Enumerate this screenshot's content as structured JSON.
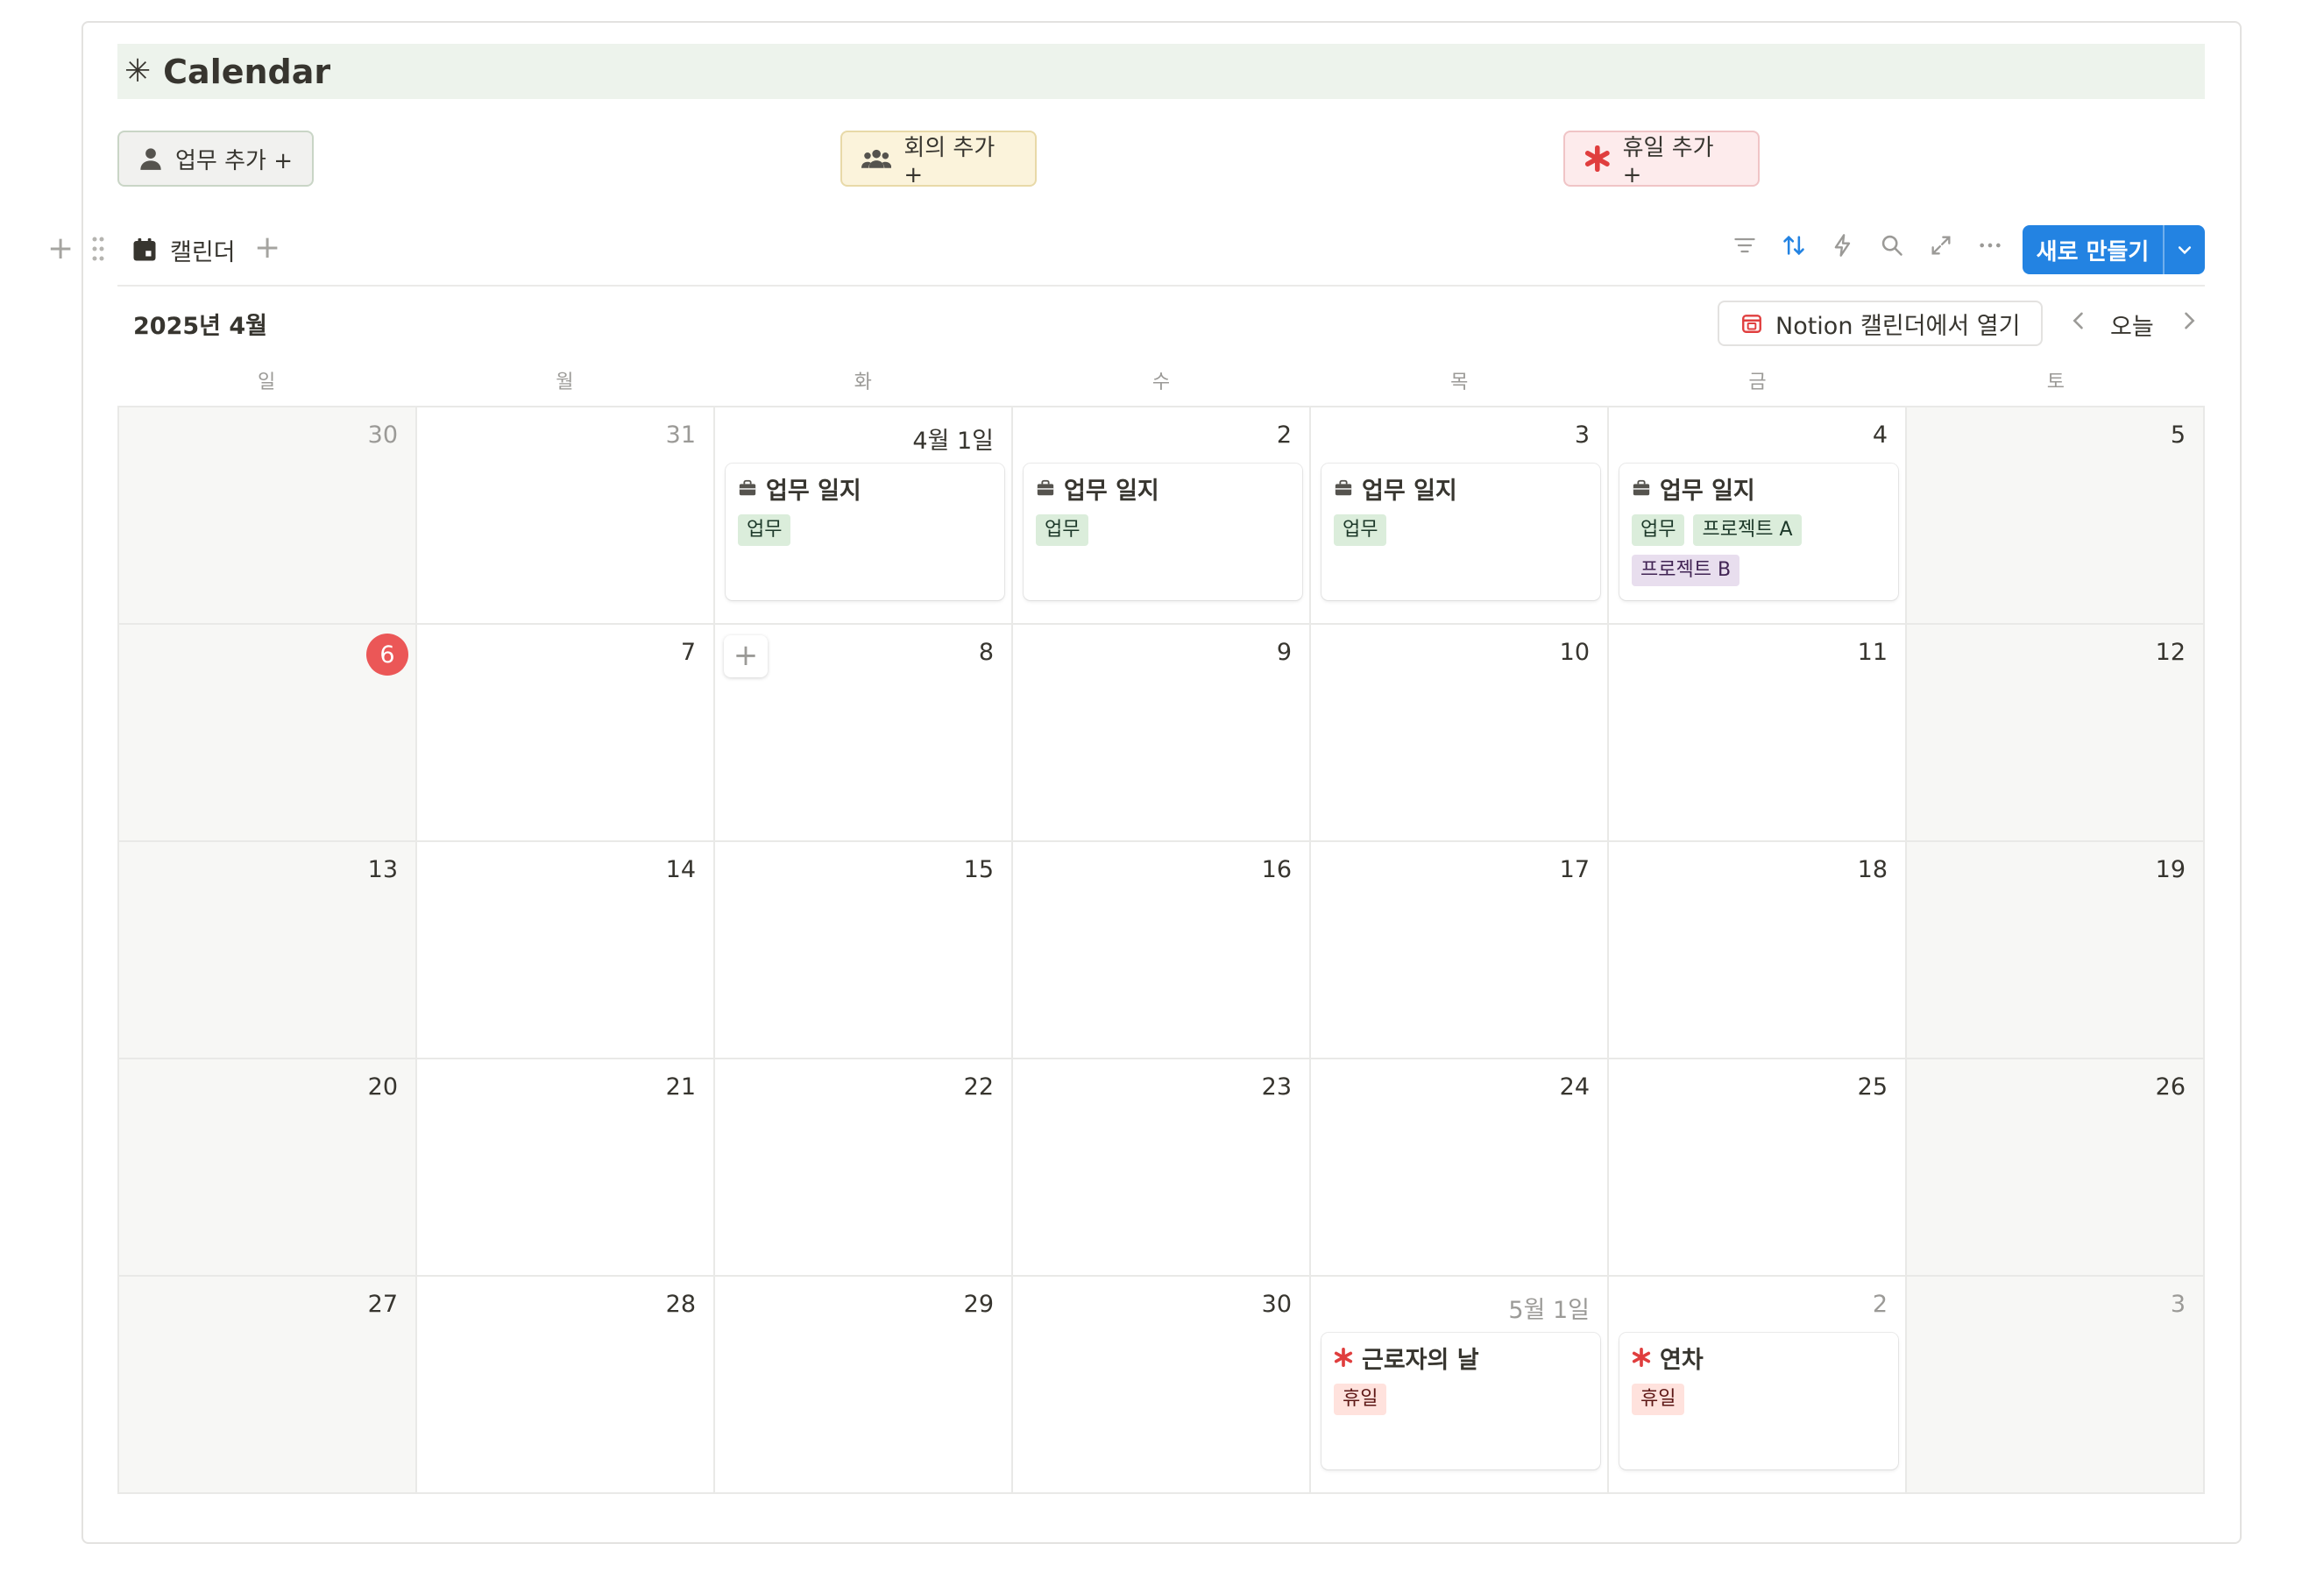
{
  "page": {
    "title": "Calendar"
  },
  "quick_buttons": {
    "task": "업무 추가 +",
    "meeting": "회의 추가 +",
    "holiday": "휴일 추가 +"
  },
  "view": {
    "tab_label": "캘린더",
    "new_button": "새로 만들기",
    "month_label": "2025년 4월",
    "open_in_calendar": "Notion 캘린더에서 열기",
    "today_label": "오늘"
  },
  "weekdays": [
    "일",
    "월",
    "화",
    "수",
    "목",
    "금",
    "토"
  ],
  "colors": {
    "accent": "#2383e2",
    "today": "#eb5757",
    "title_bg": "#edf3ec"
  },
  "calendar": {
    "cells": [
      {
        "day": "30",
        "muted": true,
        "weekend": true
      },
      {
        "day": "31",
        "muted": true
      },
      {
        "day": "4월 1일",
        "events": [
          {
            "title": "업무 일지",
            "icon": "briefcase-icon",
            "tags": [
              {
                "label": "업무",
                "color": "green"
              }
            ]
          }
        ]
      },
      {
        "day": "2",
        "events": [
          {
            "title": "업무 일지",
            "icon": "briefcase-icon",
            "tags": [
              {
                "label": "업무",
                "color": "green"
              }
            ]
          }
        ]
      },
      {
        "day": "3",
        "events": [
          {
            "title": "업무 일지",
            "icon": "briefcase-icon",
            "tags": [
              {
                "label": "업무",
                "color": "green"
              }
            ]
          }
        ]
      },
      {
        "day": "4",
        "events": [
          {
            "title": "업무 일지",
            "icon": "briefcase-icon",
            "tags": [
              {
                "label": "업무",
                "color": "green"
              },
              {
                "label": "프로젝트 A",
                "color": "green"
              },
              {
                "label": "프로젝트 B",
                "color": "purple"
              }
            ]
          }
        ]
      },
      {
        "day": "5",
        "weekend": true
      },
      {
        "day": "6",
        "today": true,
        "weekend": true
      },
      {
        "day": "7"
      },
      {
        "day": "8",
        "add": true
      },
      {
        "day": "9"
      },
      {
        "day": "10"
      },
      {
        "day": "11"
      },
      {
        "day": "12",
        "weekend": true
      },
      {
        "day": "13",
        "weekend": true
      },
      {
        "day": "14"
      },
      {
        "day": "15"
      },
      {
        "day": "16"
      },
      {
        "day": "17"
      },
      {
        "day": "18"
      },
      {
        "day": "19",
        "weekend": true
      },
      {
        "day": "20",
        "weekend": true
      },
      {
        "day": "21"
      },
      {
        "day": "22"
      },
      {
        "day": "23"
      },
      {
        "day": "24"
      },
      {
        "day": "25"
      },
      {
        "day": "26",
        "weekend": true
      },
      {
        "day": "27",
        "weekend": true
      },
      {
        "day": "28"
      },
      {
        "day": "29"
      },
      {
        "day": "30"
      },
      {
        "day": "5월 1일",
        "muted": true,
        "events": [
          {
            "title": "근로자의 날",
            "icon": "asterisk-icon",
            "tags": [
              {
                "label": "휴일",
                "color": "red"
              }
            ]
          }
        ]
      },
      {
        "day": "2",
        "muted": true,
        "events": [
          {
            "title": "연차",
            "icon": "asterisk-icon",
            "tags": [
              {
                "label": "휴일",
                "color": "red"
              }
            ]
          }
        ]
      },
      {
        "day": "3",
        "muted": true,
        "weekend": true
      }
    ]
  }
}
